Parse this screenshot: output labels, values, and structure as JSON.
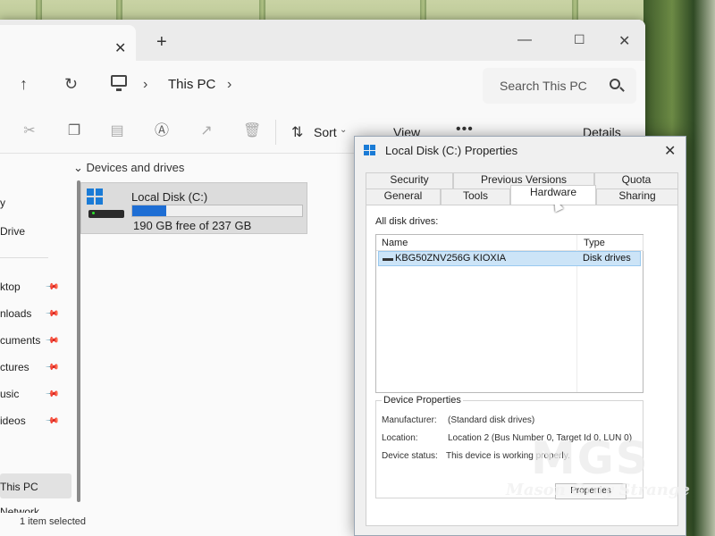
{
  "explorer": {
    "breadcrumb": "This PC",
    "search_placeholder": "Search This PC",
    "toolbar": {
      "sort_label": "Sort",
      "view_label": "View",
      "details_label": "Details"
    },
    "sidebar": [
      {
        "label": "y"
      },
      {
        "label": "Drive"
      },
      {
        "label": "ktop"
      },
      {
        "label": "nloads"
      },
      {
        "label": "cuments"
      },
      {
        "label": "ctures"
      },
      {
        "label": "usic"
      },
      {
        "label": "ideos"
      },
      {
        "label": "This PC"
      },
      {
        "label": "Network"
      }
    ],
    "group_header": "Devices and drives",
    "drive": {
      "name": "Local Disk (C:)",
      "free_text": "190 GB free of 237 GB",
      "used_fraction": 0.198
    },
    "status": "1 item selected"
  },
  "dialog": {
    "title": "Local Disk (C:) Properties",
    "tabs_row1": [
      "Security",
      "Previous Versions",
      "Quota"
    ],
    "tabs_row2": [
      "General",
      "Tools",
      "Hardware",
      "Sharing"
    ],
    "active_tab": "Hardware",
    "all_drives_label": "All disk drives:",
    "columns": [
      "Name",
      "Type"
    ],
    "rows": [
      {
        "name": "KBG50ZNV256G KIOXIA",
        "type": "Disk drives"
      }
    ],
    "device_properties": {
      "title": "Device Properties",
      "manufacturer_label": "Manufacturer:",
      "manufacturer": "(Standard disk drives)",
      "location_label": "Location:",
      "location": "Location 2 (Bus Number 0, Target Id 0, LUN 0)",
      "status_label": "Device status:",
      "status": "This device is working properly.",
      "button": "Properties"
    }
  },
  "watermark": {
    "logo": "MGS",
    "text": "Mason Gray Strange"
  },
  "colors": {
    "accent": "#1e6ed4",
    "selection": "#cce4f7"
  }
}
